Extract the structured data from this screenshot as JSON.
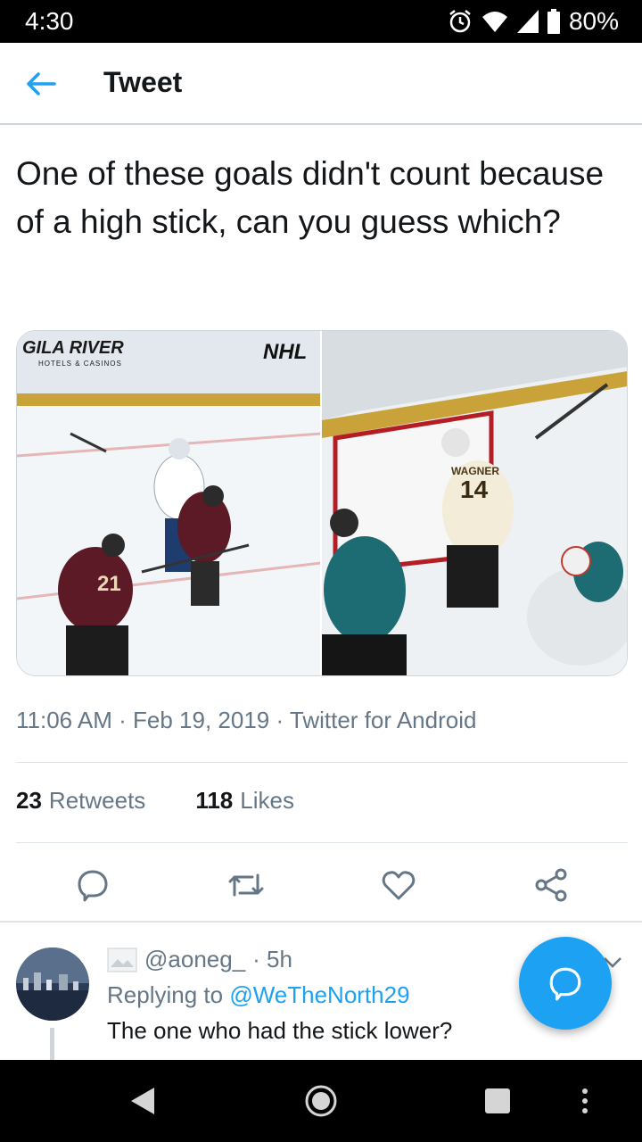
{
  "status_bar": {
    "time": "4:30",
    "battery": "80%",
    "icons": [
      "alarm-icon",
      "wifi-icon",
      "signal-icon",
      "battery-icon"
    ]
  },
  "header": {
    "title": "Tweet",
    "back_icon": "back-arrow-icon"
  },
  "tweet": {
    "text": "One of these goals didn't count because of a high stick, can you guess which?",
    "media": {
      "left_board_text": "GILA RIVER",
      "left_board_subtext": "HOTELS & CASINOS",
      "left_logo_text": "NHL",
      "left_jersey_number": "21",
      "right_player_name": "WAGNER",
      "right_jersey_number": "14"
    },
    "meta": "11:06 AM · Feb 19, 2019 · Twitter for Android",
    "retweets_count": "23",
    "retweets_label": "Retweets",
    "likes_count": "118",
    "likes_label": "Likes",
    "actions": [
      "reply-icon",
      "retweet-icon",
      "like-icon",
      "share-icon"
    ]
  },
  "reply": {
    "handle": "@aoneg_",
    "time": "· 5h",
    "replying_prefix": "Replying to",
    "replying_to": "@WeTheNorth29",
    "text": "The one who had the stick lower?"
  },
  "colors": {
    "accent": "#1da1f2",
    "text": "#14171a",
    "secondary": "#657786",
    "divider": "#dfe4e8"
  }
}
